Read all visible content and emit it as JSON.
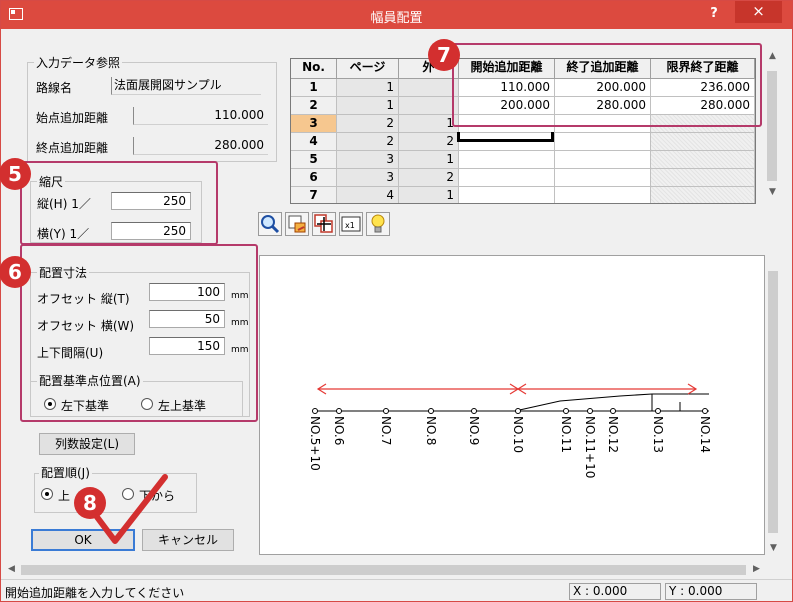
{
  "window": {
    "title": "幅員配置",
    "help": "?",
    "close": "×"
  },
  "input_ref": {
    "group_title": "入力データ参照",
    "route_label": "路線名",
    "route_value": "法面展開図サンプル",
    "start_label": "始点追加距離",
    "start_value": "110.000",
    "end_label": "終点追加距離",
    "end_value": "280.000"
  },
  "scale": {
    "group_title": "縮尺",
    "vertical_label": "縦(H) 1／",
    "vertical_value": "250",
    "horizontal_label": "横(Y) 1／",
    "horizontal_value": "250"
  },
  "layout": {
    "group_title": "配置寸法",
    "offset_v_label": "オフセット 縦(T)",
    "offset_v_value": "100",
    "offset_h_label": "オフセット 横(W)",
    "offset_h_value": "50",
    "spacing_label": "上下間隔(U)",
    "spacing_value": "150",
    "unit": "mm",
    "ref_group_title": "配置基準点位置(A)",
    "ref_opt1": "左下基準",
    "ref_opt2": "左上基準"
  },
  "column_button": "列数設定(L)",
  "order": {
    "group_title": "配置順(J)",
    "opt1": "上",
    "opt2": "下から"
  },
  "ok": "OK",
  "cancel": "キャンセル",
  "badges": {
    "b5": "5",
    "b6": "6",
    "b7": "7",
    "b8": "8"
  },
  "grid": {
    "headers": [
      "No.",
      "ページ",
      "外",
      "開始追加距離",
      "終了追加距離",
      "限界終了距離"
    ],
    "rows": [
      {
        "no": "1",
        "page": "1",
        "c3": "",
        "start": "110.000",
        "end": "200.000",
        "limit": "236.000"
      },
      {
        "no": "2",
        "page": "1",
        "c3": "",
        "start": "200.000",
        "end": "280.000",
        "limit": "280.000"
      },
      {
        "no": "3",
        "page": "2",
        "c3": "1",
        "start": "",
        "end": "",
        "limit": ""
      },
      {
        "no": "4",
        "page": "2",
        "c3": "2",
        "start": "",
        "end": "",
        "limit": ""
      },
      {
        "no": "5",
        "page": "3",
        "c3": "1",
        "start": "",
        "end": "",
        "limit": ""
      },
      {
        "no": "6",
        "page": "3",
        "c3": "2",
        "start": "",
        "end": "",
        "limit": ""
      },
      {
        "no": "7",
        "page": "4",
        "c3": "1",
        "start": "",
        "end": "",
        "limit": ""
      }
    ]
  },
  "toolbar": [
    "zoom-icon",
    "fit-icon",
    "move-icon",
    "actual-size-icon",
    "hint-icon"
  ],
  "stations": [
    "NO.5+10",
    "NO.6",
    "NO.7",
    "NO.8",
    "NO.9",
    "NO.10",
    "NO.11",
    "NO.11+10",
    "NO.12",
    "NO.13",
    "NO.14"
  ],
  "colors": {
    "title_bar": "#dc4a3f",
    "annotation": "#b53a6a",
    "badge": "#d32f2f",
    "range_arrow": "#e53935",
    "selected_row": "#f6c78f"
  },
  "status": {
    "message": "開始追加距離を入力してください",
    "x": "X : 0.000",
    "y": "Y : 0.000"
  }
}
